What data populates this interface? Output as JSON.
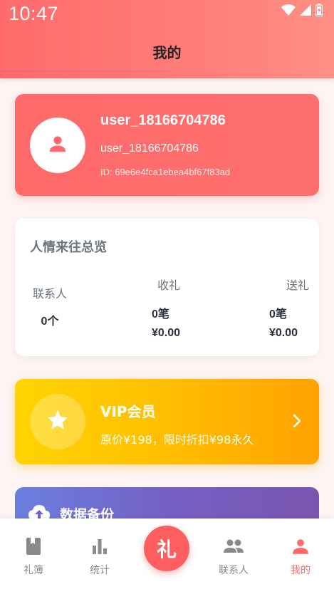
{
  "status_bar": {
    "time": "10:47",
    "icons": [
      "wifi-icon",
      "signal-icon",
      "battery-icon"
    ]
  },
  "header": {
    "title": "我的"
  },
  "profile": {
    "name": "user_18166704786",
    "username": "user_18166704786",
    "id_text": "ID: 69e6e4fca1ebea4bf67f83ad",
    "avatar_icon": "person-icon"
  },
  "overview": {
    "title": "人情来往总览",
    "contacts_label": "联系人",
    "contacts_value": "0个",
    "received_label": "收礼",
    "received_count": "0笔",
    "received_amount": "¥0.00",
    "sent_label": "送礼",
    "sent_count": "0笔",
    "sent_amount": "¥0.00"
  },
  "vip": {
    "title": "VIP会员",
    "description": "原价¥198，限时折扣¥98永久",
    "icon": "star-icon",
    "chevron": "chevron-right-icon"
  },
  "backup": {
    "title": "数据备份",
    "icon": "cloud-upload-icon"
  },
  "bottom_nav": {
    "items": [
      {
        "label": "礼簿",
        "icon": "book-icon"
      },
      {
        "label": "统计",
        "icon": "bar-chart-icon"
      },
      {
        "label": "联系人",
        "icon": "people-icon"
      },
      {
        "label": "我的",
        "icon": "person-icon"
      }
    ],
    "center_label": "礼",
    "active_index": 3
  },
  "colors": {
    "primary": "#ff6b6b",
    "vip_gold": "#ffbe00",
    "backup_purple": "#7560c4",
    "text_dark": "#2a3240",
    "text_muted": "#6b7580"
  }
}
